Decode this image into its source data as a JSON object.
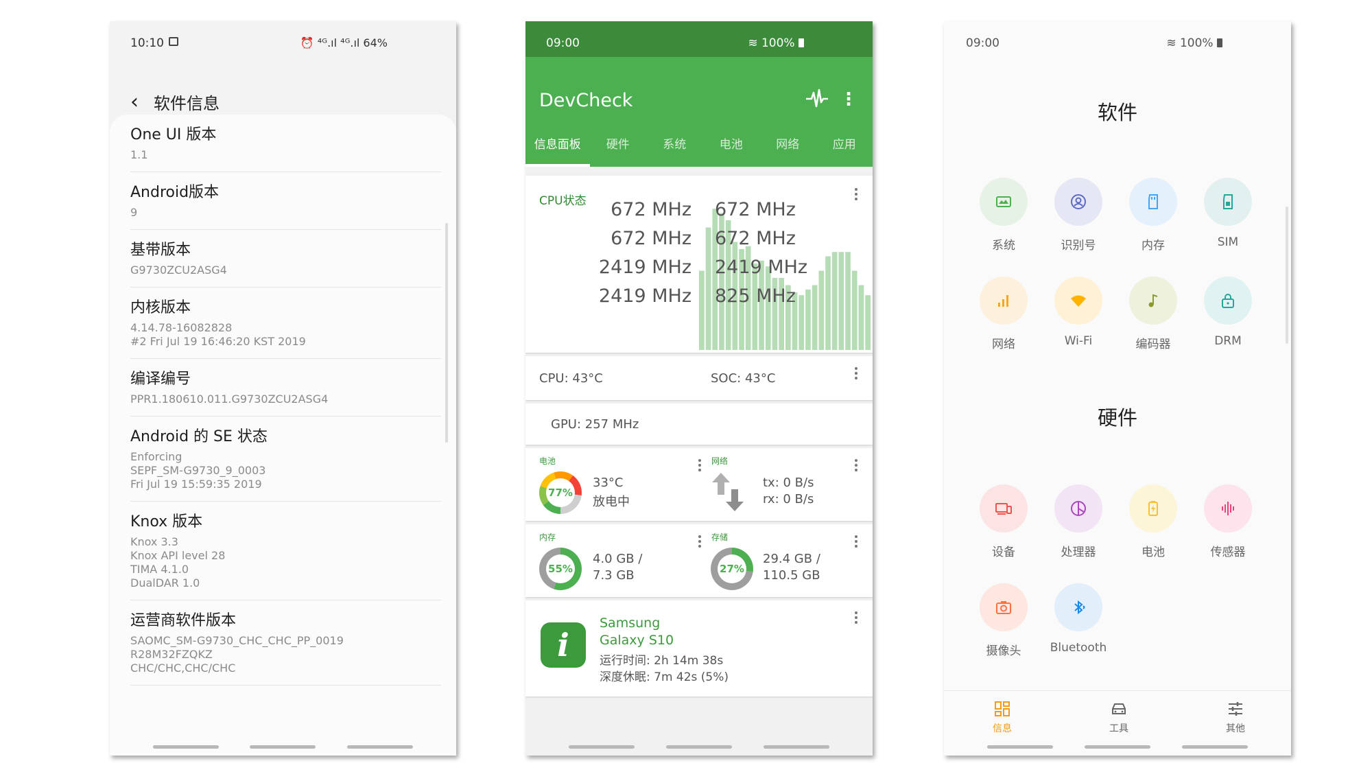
{
  "phone1": {
    "status": {
      "time": "10:10",
      "right": "⏰ ⁴ᴳ.ıl ⁴ᴳ.ıl 64%"
    },
    "header": {
      "title": "软件信息"
    },
    "items": [
      {
        "title": "One UI 版本",
        "value": "1.1"
      },
      {
        "title": "Android版本",
        "value": "9"
      },
      {
        "title": "基带版本",
        "value": "G9730ZCU2ASG4"
      },
      {
        "title": "内核版本",
        "value": "4.14.78-16082828\n#2 Fri Jul 19 16:46:20 KST 2019"
      },
      {
        "title": "编译编号",
        "value": "PPR1.180610.011.G9730ZCU2ASG4"
      },
      {
        "title": "Android 的 SE 状态",
        "value": "Enforcing\nSEPF_SM-G9730_9_0003\nFri Jul 19 15:59:35 2019"
      },
      {
        "title": "Knox 版本",
        "value": "Knox 3.3\nKnox API level 28\nTIMA 4.1.0\nDualDAR 1.0"
      },
      {
        "title": "运营商软件版本",
        "value": "SAOMC_SM-G9730_CHC_CHC_PP_0019\nR28M32FZQKZ\nCHC/CHC,CHC/CHC"
      }
    ]
  },
  "phone2": {
    "status": {
      "time": "09:00",
      "right": "100%"
    },
    "title": "DevCheck",
    "tabs": [
      "信息面板",
      "硬件",
      "系统",
      "电池",
      "网络",
      "应用"
    ],
    "cpu": {
      "label": "CPU状态",
      "left_freqs": [
        "672 MHz",
        "672 MHz",
        "2419 MHz",
        "2419 MHz"
      ],
      "right_freqs": [
        "672 MHz",
        "672 MHz",
        "2419 MHz",
        "825 MHz"
      ],
      "bars": [
        0.55,
        0.85,
        0.98,
        0.95,
        0.9,
        0.75,
        0.7,
        0.72,
        0.6,
        0.62,
        0.58,
        0.5,
        0.5,
        0.45,
        0.4,
        0.38,
        0.42,
        0.45,
        0.55,
        0.65,
        0.68,
        0.68,
        0.68,
        0.55,
        0.45,
        0.38
      ],
      "colors": {
        "bar": "#b6dcb6",
        "accent": "#4caf50"
      }
    },
    "temps": {
      "cpu": "CPU: 43°C",
      "soc": "SOC: 43°C"
    },
    "gpu": "GPU: 257 MHz",
    "battery": {
      "label": "电池",
      "percent": "77%",
      "level": 0.77,
      "temp": "33°C",
      "status": "放电中"
    },
    "network": {
      "label": "网络",
      "tx": "tx: 0 B/s",
      "rx": "rx: 0 B/s"
    },
    "memory": {
      "label": "内存",
      "percent": "55%",
      "level": 0.55,
      "used": "4.0 GB /",
      "total": "7.3 GB"
    },
    "storage": {
      "label": "存储",
      "percent": "27%",
      "level": 0.27,
      "used": "29.4 GB /",
      "total": "110.5 GB"
    },
    "device": {
      "brand": "Samsung",
      "model": "Galaxy S10",
      "uptime": "运行时间: 2h 14m 38s",
      "sleep": "深度休眠: 7m 42s (5%)"
    }
  },
  "phone3": {
    "status": {
      "time": "09:00",
      "right": "100%"
    },
    "software_title": "软件",
    "hardware_title": "硬件",
    "software": [
      {
        "label": "系统",
        "icon": "system-icon",
        "color": "#4caf50",
        "bg": "#e6f2e6"
      },
      {
        "label": "识别号",
        "icon": "id-icon",
        "color": "#5c6bc0",
        "bg": "#e6e7f5"
      },
      {
        "label": "内存",
        "icon": "memory-icon",
        "color": "#42a5f5",
        "bg": "#e4f0fb"
      },
      {
        "label": "SIM",
        "icon": "sim-icon",
        "color": "#26a69a",
        "bg": "#e2f1ef"
      },
      {
        "label": "网络",
        "icon": "network-icon",
        "color": "#f5a623",
        "bg": "#fdf1de"
      },
      {
        "label": "Wi-Fi",
        "icon": "wifi-icon",
        "color": "#ffb300",
        "bg": "#fff1d6"
      },
      {
        "label": "编码器",
        "icon": "codec-icon",
        "color": "#8d9b2c",
        "bg": "#eef1dc"
      },
      {
        "label": "DRM",
        "icon": "lock-icon",
        "color": "#26a69a",
        "bg": "#e0f2f1"
      }
    ],
    "hardware": [
      {
        "label": "设备",
        "icon": "device-icon",
        "color": "#ef5350",
        "bg": "#fce4e4"
      },
      {
        "label": "处理器",
        "icon": "processor-icon",
        "color": "#ab47bc",
        "bg": "#f2e3f5"
      },
      {
        "label": "电池",
        "icon": "battery-icon",
        "color": "#fbc02d",
        "bg": "#fdf5d8"
      },
      {
        "label": "传感器",
        "icon": "sensor-icon",
        "color": "#ec407a",
        "bg": "#fce3ec"
      },
      {
        "label": "摄像头",
        "icon": "camera-icon",
        "color": "#ff7043",
        "bg": "#fde7e0"
      },
      {
        "label": "Bluetooth",
        "icon": "bluetooth-icon",
        "color": "#1e88e5",
        "bg": "#e3eefb"
      }
    ],
    "bottom_nav": [
      {
        "label": "信息",
        "icon": "dashboard-icon",
        "active": true
      },
      {
        "label": "工具",
        "icon": "tools-icon",
        "active": false
      },
      {
        "label": "其他",
        "icon": "settings-sliders-icon",
        "active": false
      }
    ]
  }
}
